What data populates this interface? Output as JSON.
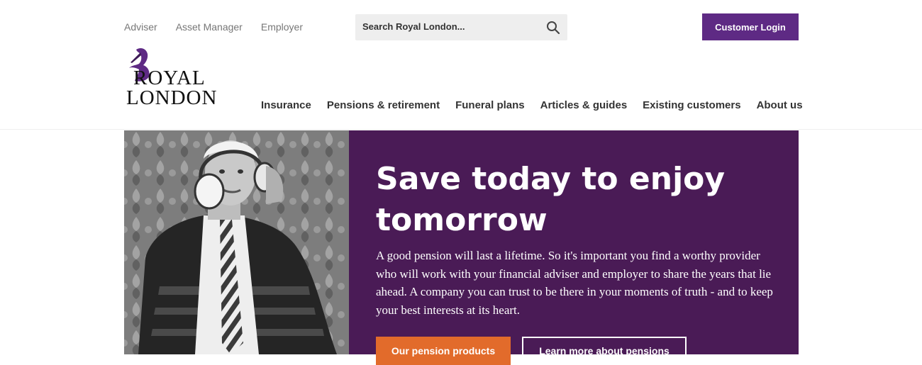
{
  "header": {
    "top_links": [
      "Adviser",
      "Asset Manager",
      "Employer"
    ],
    "search_placeholder": "Search Royal London...",
    "login_label": "Customer Login",
    "logo": {
      "line1": "ROYAL",
      "line2": "LONDON"
    },
    "nav": [
      "Insurance",
      "Pensions & retirement",
      "Funeral plans",
      "Articles & guides",
      "Existing customers",
      "About us"
    ]
  },
  "hero": {
    "title": "Save today to enjoy tomorrow",
    "body": "A good pension will last a lifetime. So it's important you find a worthy provider who will work with your financial adviser and employer to share the years that lie ahead.  A company you can trust to be there in your moments of truth - and to keep your best interests at its heart.",
    "primary_button": "Our pension products",
    "secondary_button": "Learn more about pensions"
  },
  "colors": {
    "brand_purple": "#5e2a84",
    "hero_purple": "#4a1b56",
    "accent_orange": "#e26b2b"
  }
}
